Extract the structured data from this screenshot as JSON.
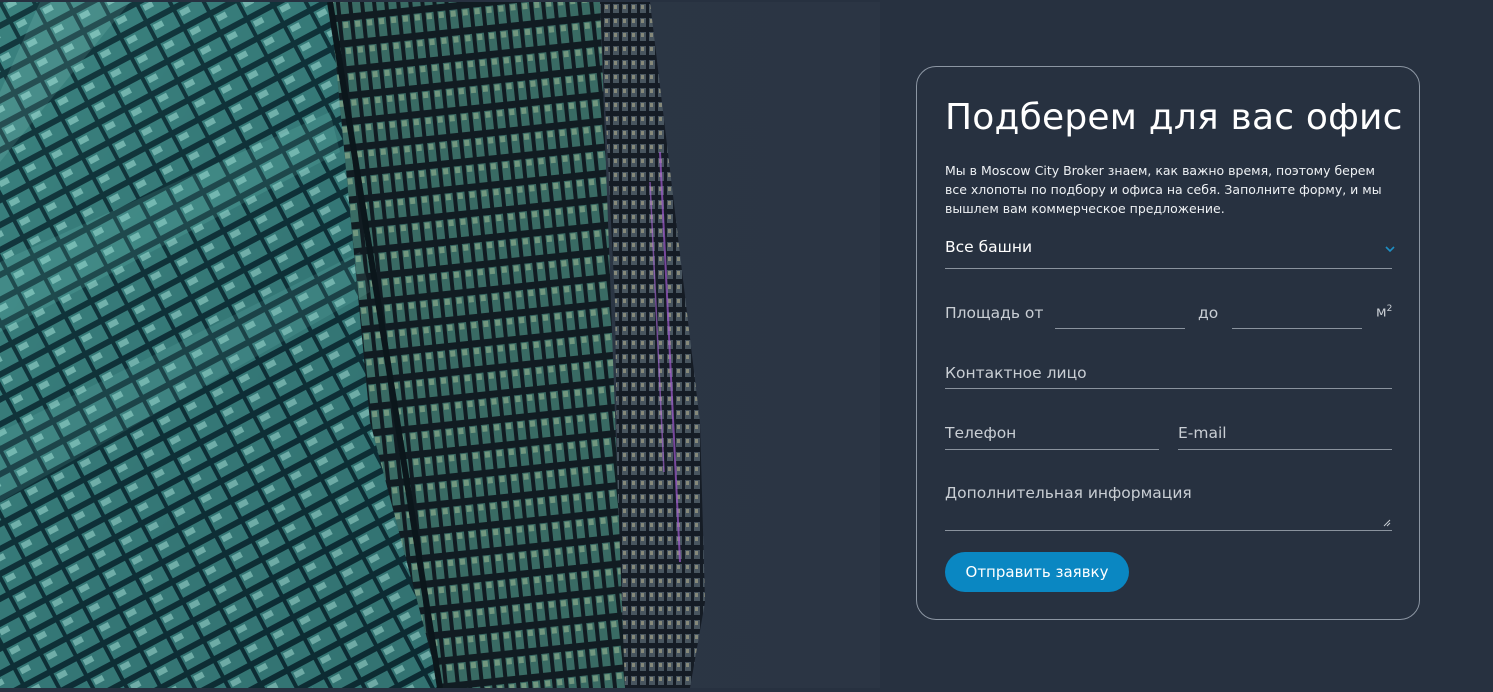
{
  "form": {
    "title": "Подберем для вас офис",
    "description": "Мы в Moscow City Broker знаем, как важно время, поэтому берем все хлопоты по подбору и офиса на себя. Заполните форму, и мы вышлем вам коммерческое предложение.",
    "tower_select": {
      "value": "Все башни",
      "icon": "chevron-down-icon"
    },
    "area": {
      "from_label": "Площадь от",
      "to_label": "до",
      "unit": "м",
      "unit_sup": "2"
    },
    "contact_placeholder": "Контактное лицо",
    "phone_placeholder": "Телефон",
    "email_placeholder": "E-mail",
    "info_placeholder": "Дополнительная информация",
    "submit_label": "Отправить заявку"
  },
  "colors": {
    "background": "#273140",
    "accent": "#0a87c2",
    "text": "#ffffff",
    "muted": "#c9ced4"
  }
}
